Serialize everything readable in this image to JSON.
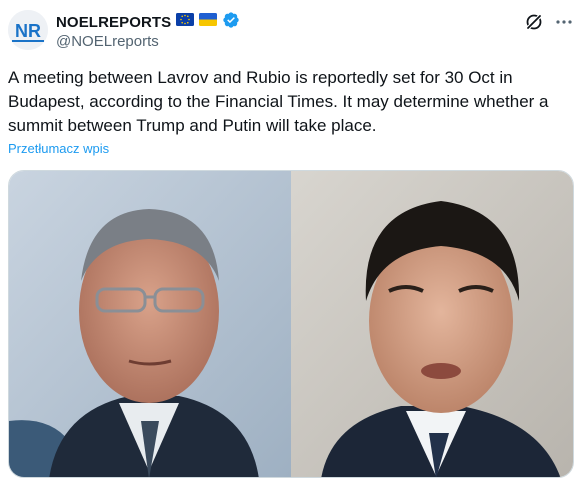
{
  "author": {
    "avatar_text": "NR",
    "display_name": "NOELREPORTS",
    "flags": [
      "eu-flag-icon",
      "ukraine-flag-icon"
    ],
    "verified": true,
    "handle": "@NOELreports"
  },
  "actions": {
    "grok_icon": "grok-icon",
    "more_icon": "more-icon"
  },
  "tweet": {
    "text": "A meeting between Lavrov and Rubio is reportedly set for 30 Oct in Budapest, according to the Financial Times. It may determine whether a summit between Trump and Putin will take place.",
    "translate_label": "Przetłumacz wpis"
  },
  "media": {
    "photos": [
      {
        "alt": ""
      },
      {
        "alt": ""
      }
    ]
  },
  "colors": {
    "text": "#0f1419",
    "secondary": "#536471",
    "link": "#1d9bf0",
    "verified": "#1d9bf0",
    "avatar_brand": "#1a73c8"
  }
}
